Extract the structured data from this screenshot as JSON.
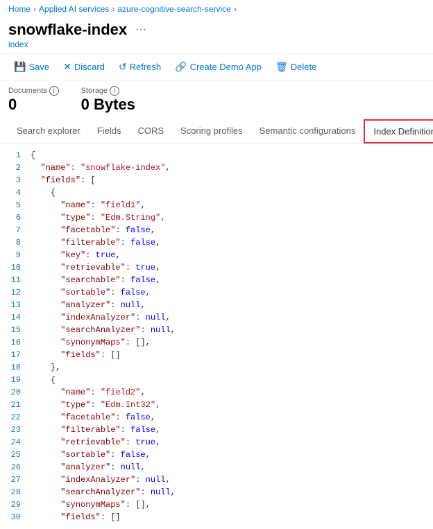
{
  "breadcrumb": {
    "items": [
      "Home",
      "Applied AI services",
      "azure-cognitive-search-service"
    ],
    "separators": [
      ">",
      ">"
    ]
  },
  "page": {
    "title": "snowflake-index",
    "subtitle": "index",
    "ellipsis": "···"
  },
  "toolbar": {
    "buttons": [
      {
        "id": "save",
        "icon": "💾",
        "label": "Save"
      },
      {
        "id": "discard",
        "icon": "✕",
        "label": "Discard"
      },
      {
        "id": "refresh",
        "icon": "↺",
        "label": "Refresh"
      },
      {
        "id": "create-demo",
        "icon": "🔗",
        "label": "Create Demo App"
      },
      {
        "id": "delete",
        "icon": "🗑",
        "label": "Delete"
      }
    ]
  },
  "stats": {
    "documents": {
      "label": "Documents",
      "value": "0"
    },
    "storage": {
      "label": "Storage",
      "value": "0 Bytes"
    }
  },
  "tabs": [
    {
      "id": "search-explorer",
      "label": "Search explorer",
      "active": false
    },
    {
      "id": "fields",
      "label": "Fields",
      "active": false
    },
    {
      "id": "cors",
      "label": "CORS",
      "active": false
    },
    {
      "id": "scoring-profiles",
      "label": "Scoring profiles",
      "active": false
    },
    {
      "id": "semantic-configurations",
      "label": "Semantic configurations",
      "active": false
    },
    {
      "id": "index-definition",
      "label": "Index Definition (JSON)",
      "active": true,
      "highlighted": true
    }
  ],
  "code": {
    "lines": [
      {
        "num": 1,
        "text": "{"
      },
      {
        "num": 2,
        "text": "  \"name\": \"snowflake-index\","
      },
      {
        "num": 3,
        "text": "  \"fields\": ["
      },
      {
        "num": 4,
        "text": "    {"
      },
      {
        "num": 5,
        "text": "      \"name\": \"field1\","
      },
      {
        "num": 6,
        "text": "      \"type\": \"Edm.String\","
      },
      {
        "num": 7,
        "text": "      \"facetable\": false,"
      },
      {
        "num": 8,
        "text": "      \"filterable\": false,"
      },
      {
        "num": 9,
        "text": "      \"key\": true,"
      },
      {
        "num": 10,
        "text": "      \"retrievable\": true,"
      },
      {
        "num": 11,
        "text": "      \"searchable\": false,"
      },
      {
        "num": 12,
        "text": "      \"sortable\": false,"
      },
      {
        "num": 13,
        "text": "      \"analyzer\": null,"
      },
      {
        "num": 14,
        "text": "      \"indexAnalyzer\": null,"
      },
      {
        "num": 15,
        "text": "      \"searchAnalyzer\": null,"
      },
      {
        "num": 16,
        "text": "      \"synonymMaps\": [],"
      },
      {
        "num": 17,
        "text": "      \"fields\": []"
      },
      {
        "num": 18,
        "text": "    },"
      },
      {
        "num": 19,
        "text": "    {"
      },
      {
        "num": 20,
        "text": "      \"name\": \"field2\","
      },
      {
        "num": 21,
        "text": "      \"type\": \"Edm.Int32\","
      },
      {
        "num": 22,
        "text": "      \"facetable\": false,"
      },
      {
        "num": 23,
        "text": "      \"filterable\": false,"
      },
      {
        "num": 24,
        "text": "      \"retrievable\": true,"
      },
      {
        "num": 25,
        "text": "      \"sortable\": false,"
      },
      {
        "num": 26,
        "text": "      \"analyzer\": null,"
      },
      {
        "num": 27,
        "text": "      \"indexAnalyzer\": null,"
      },
      {
        "num": 28,
        "text": "      \"searchAnalyzer\": null,"
      },
      {
        "num": 29,
        "text": "      \"synonymMaps\": [],"
      },
      {
        "num": 30,
        "text": "      \"fields\": []"
      }
    ]
  }
}
